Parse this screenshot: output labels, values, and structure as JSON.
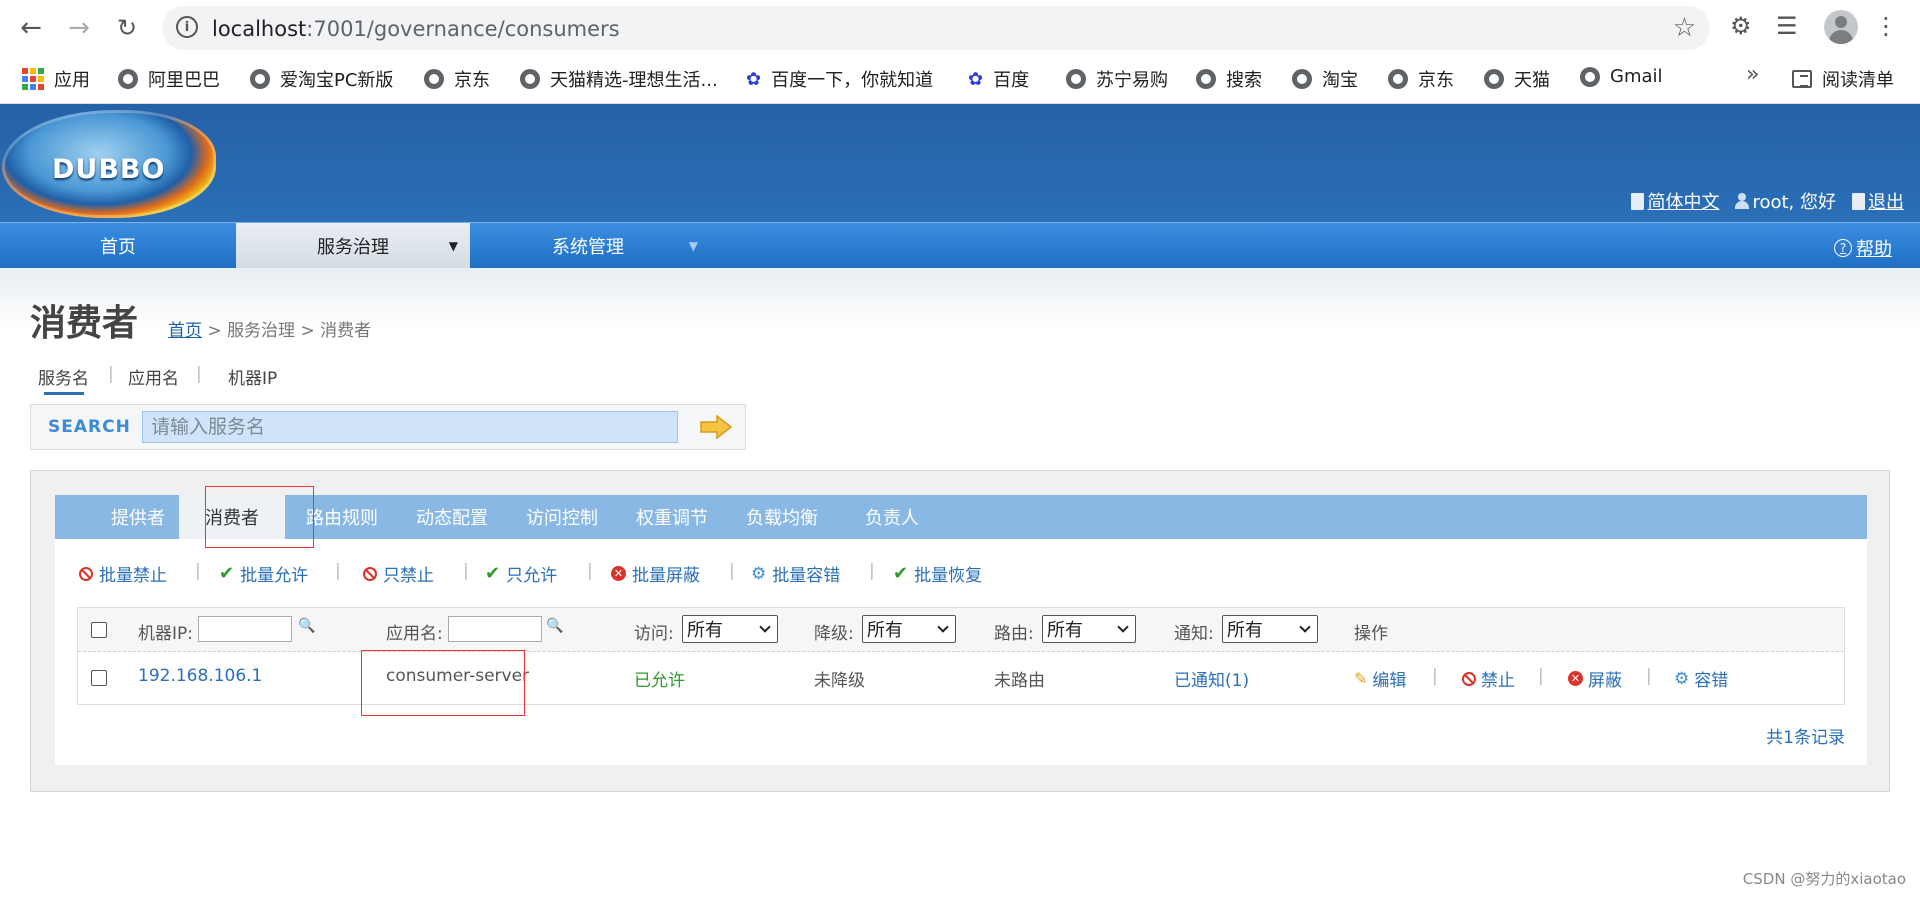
{
  "browser": {
    "url_host": "localhost",
    "url_path": ":7001/governance/consumers",
    "bookmarks": [
      "应用",
      "阿里巴巴",
      "爱淘宝PC新版",
      "京东",
      "天猫精选-理想生活...",
      "百度一下，你就知道",
      "百度",
      "苏宁易购",
      "搜索",
      "淘宝",
      "京东",
      "天猫",
      "Gmail"
    ],
    "more": "»",
    "reading_list": "阅读清单"
  },
  "header": {
    "logo_text": "DUBBO",
    "lang": "简体中文",
    "user": "root, 您好",
    "logout": "退出"
  },
  "mainnav": {
    "items": [
      "首页",
      "服务治理",
      "系统管理"
    ],
    "active": "服务治理",
    "help": "帮助"
  },
  "page": {
    "title": "消费者",
    "breadcrumb": {
      "home": "首页",
      "sep1": " > ",
      "section": "服务治理",
      "sep2": " > ",
      "current": "消费者"
    }
  },
  "search": {
    "tabs": [
      "服务名",
      "应用名",
      "机器IP"
    ],
    "active_tab": "服务名",
    "label": "SEARCH",
    "placeholder": "请输入服务名",
    "value": ""
  },
  "subtabs": {
    "items": [
      "提供者",
      "消费者",
      "路由规则",
      "动态配置",
      "访问控制",
      "权重调节",
      "负载均衡",
      "负责人"
    ],
    "active": "消费者"
  },
  "toolbar": {
    "items": [
      "批量禁止",
      "批量允许",
      "只禁止",
      "只允许",
      "批量屏蔽",
      "批量容错",
      "批量恢复"
    ]
  },
  "table": {
    "headers": {
      "ip": "机器IP:",
      "app": "应用名:",
      "access": "访问:",
      "degrade": "降级:",
      "route": "路由:",
      "notify": "通知:",
      "ops": "操作"
    },
    "filter_values": {
      "access": "所有",
      "degrade": "所有",
      "route": "所有",
      "notify": "所有"
    },
    "rows": [
      {
        "ip": "192.168.106.1",
        "app": "consumer-server",
        "access": "已允许",
        "degrade": "未降级",
        "route": "未路由",
        "notify": "已通知(1)",
        "actions": [
          "编辑",
          "禁止",
          "屏蔽",
          "容错"
        ]
      }
    ],
    "total": "共1条记录"
  },
  "watermark": "CSDN @努力的xiaotao",
  "colors": {
    "header_blue": "#2561a6",
    "nav_blue": "#2a6fb8",
    "subtab_blue": "#89b8e5",
    "highlight_red": "#e33333",
    "allowed_green": "#2e9a2e"
  }
}
